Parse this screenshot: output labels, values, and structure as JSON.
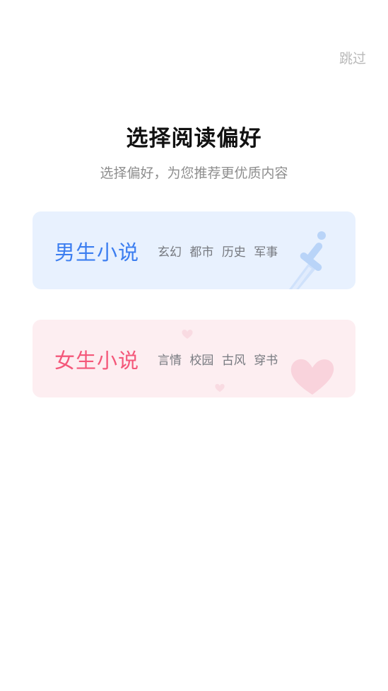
{
  "header": {
    "skip_label": "跳过"
  },
  "intro": {
    "title": "选择阅读偏好",
    "subtitle": "选择偏好，为您推荐更优质内容"
  },
  "cards": [
    {
      "title": "男生小说",
      "tags": [
        "玄幻",
        "都市",
        "历史",
        "军事"
      ],
      "decoration_icon": "sword-icon"
    },
    {
      "title": "女生小说",
      "tags": [
        "言情",
        "校园",
        "古风",
        "穿书"
      ],
      "decoration_icon": "heart-icon"
    }
  ],
  "colors": {
    "male_accent": "#3c7ef0",
    "male_card_bg": "#e8f1fe",
    "female_accent": "#f4587a",
    "female_card_bg": "#fdeef1"
  }
}
